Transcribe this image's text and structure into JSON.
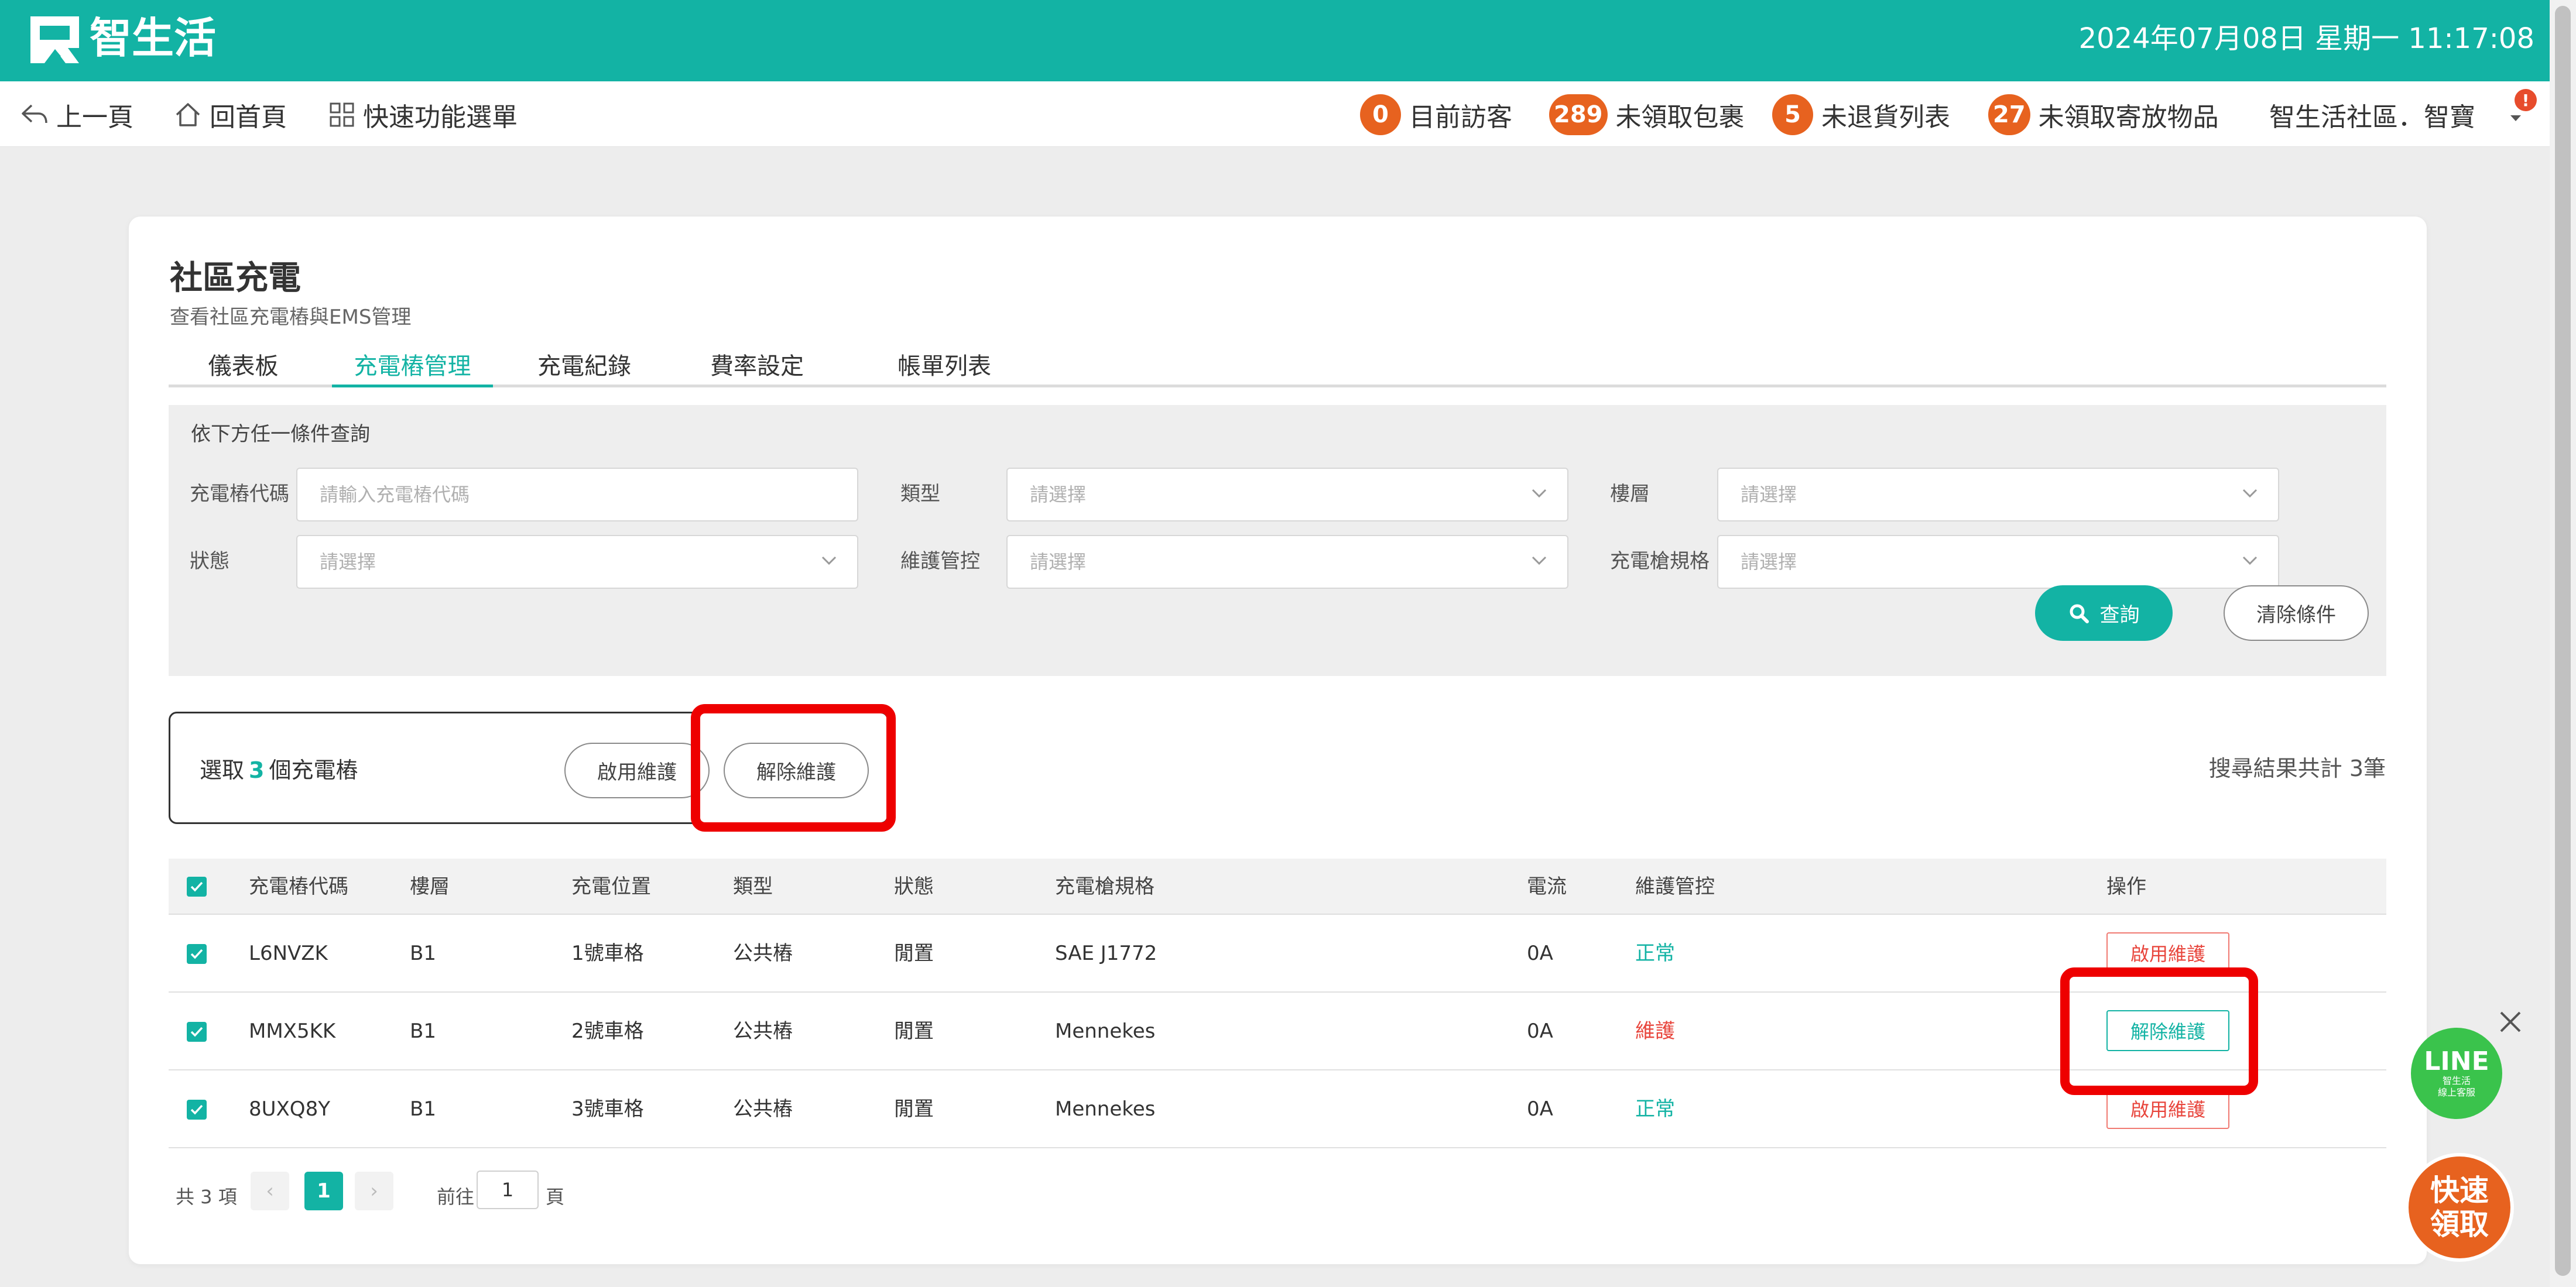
{
  "app": {
    "brand": "智生活",
    "datetime": "2024年07月08日 星期一 11:17:08",
    "colors": {
      "brand": "#13b3a4",
      "badge": "#e7621f",
      "danger": "#e8453c",
      "highlight": "#ee0000"
    }
  },
  "nav": {
    "back": "上一頁",
    "home": "回首頁",
    "menu": "快速功能選單",
    "stats": [
      {
        "count": "0",
        "label": "目前訪客"
      },
      {
        "count": "289",
        "label": "未領取包裹"
      },
      {
        "count": "5",
        "label": "未退貨列表"
      },
      {
        "count": "27",
        "label": "未領取寄放物品"
      }
    ],
    "community": "智生活社區．智寶",
    "alert": "!"
  },
  "page": {
    "title": "社區充電",
    "subtitle": "查看社區充電樁與EMS管理",
    "tabs": [
      {
        "label": "儀表板"
      },
      {
        "label": "充電樁管理",
        "active": true
      },
      {
        "label": "充電紀錄"
      },
      {
        "label": "費率設定"
      },
      {
        "label": "帳單列表"
      }
    ]
  },
  "filter": {
    "title": "依下方任一條件查詢",
    "fields": [
      {
        "label": "充電樁代碼",
        "placeholder": "請輸入充電樁代碼"
      },
      {
        "label": "類型",
        "placeholder": "請選擇"
      },
      {
        "label": "樓層",
        "placeholder": "請選擇"
      },
      {
        "label": "狀態",
        "placeholder": "請選擇"
      },
      {
        "label": "維護管控",
        "placeholder": "請選擇"
      },
      {
        "label": "充電槍規格",
        "placeholder": "請選擇"
      }
    ],
    "query_label": "查詢",
    "clear_label": "清除條件"
  },
  "selection": {
    "prefix": "選取",
    "count": "3",
    "suffix": "個充電樁",
    "enable_label": "啟用維護",
    "disable_label": "解除維護",
    "result_text": "搜尋結果共計 3筆"
  },
  "table": {
    "headers": [
      "充電樁代碼",
      "樓層",
      "充電位置",
      "類型",
      "狀態",
      "充電槍規格",
      "電流",
      "維護管控",
      "操作"
    ],
    "rows": [
      {
        "code": "L6NVZK",
        "floor": "B1",
        "position": "1號車格",
        "type": "公共樁",
        "status": "閒置",
        "spec": "SAE J1772",
        "current": "0A",
        "maintenance": "正常",
        "action": "啟用維護"
      },
      {
        "code": "MMX5KK",
        "floor": "B1",
        "position": "2號車格",
        "type": "公共樁",
        "status": "閒置",
        "spec": "Mennekes",
        "current": "0A",
        "maintenance": "維護",
        "action": "解除維護"
      },
      {
        "code": "8UXQ8Y",
        "floor": "B1",
        "position": "3號車格",
        "type": "公共樁",
        "status": "閒置",
        "spec": "Mennekes",
        "current": "0A",
        "maintenance": "正常",
        "action": "啟用維護"
      }
    ]
  },
  "pagination": {
    "total": "共 3 項",
    "prev": "‹",
    "page": "1",
    "next": "›",
    "goto_prefix": "前往",
    "goto_value": "1",
    "goto_suffix": "頁"
  },
  "floating": {
    "line_main": "LINE",
    "line_sub1": "智生活",
    "line_sub2": "線上客服",
    "quick_line1": "快速",
    "quick_line2": "領取"
  }
}
